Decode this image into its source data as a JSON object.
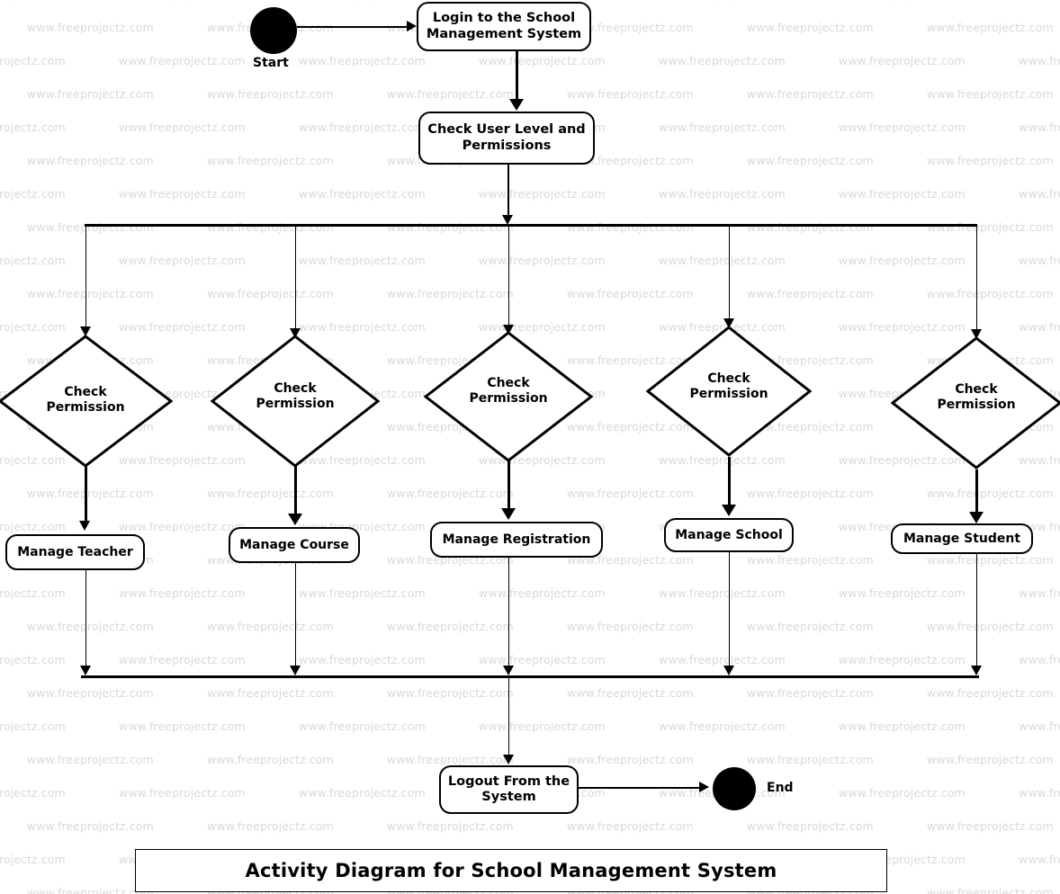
{
  "diagram": {
    "title": "Activity Diagram for School Management System",
    "watermark_text": "www.freeprojectz.com",
    "start_label": "Start",
    "end_label": "End",
    "login_activity": "Login to the School Management System",
    "check_user_activity": "Check User Level and Permissions",
    "logout_activity": "Logout From the System",
    "branches": [
      {
        "decision": "Check\nPermission",
        "activity": "Manage Teacher"
      },
      {
        "decision": "Check\nPermission",
        "activity": "Manage Course"
      },
      {
        "decision": "Check\nPermission",
        "activity": "Manage Registration"
      },
      {
        "decision": "Check\nPermission",
        "activity": "Manage School"
      },
      {
        "decision": "Check\nPermission",
        "activity": "Manage Student"
      }
    ],
    "colors": {
      "stroke": "#000000",
      "fill": "#ffffff",
      "watermark": "#d9d9d9"
    }
  }
}
